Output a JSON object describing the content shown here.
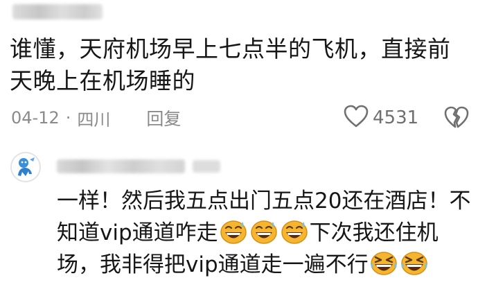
{
  "comment": {
    "text": "谁懂，天府机场早上七点半的飞机，直接前天晚上在机场睡的",
    "date": "04-12",
    "separator": "·",
    "location": "四川",
    "reply_label": "回复",
    "like_count": "4531",
    "icons": {
      "like": "heart-outline-icon",
      "dislike": "broken-heart-icon"
    }
  },
  "reply": {
    "text_part1": "一样！然后我五点出门五点20还在酒店！不知道vip通道咋走",
    "text_part2": "下次我还住机场，我非得把vip通道走一遍不行",
    "emojis": {
      "middle": [
        "grinning-sweat-emoji",
        "grinning-sweat-emoji",
        "grinning-sweat-emoji"
      ],
      "end": [
        "laughing-squint-emoji",
        "laughing-squint-emoji"
      ]
    }
  },
  "colors": {
    "text": "#161616",
    "meta": "#8a8a8a",
    "emoji_face": "#f6b531",
    "emoji_sweat": "#6cc3f2"
  }
}
